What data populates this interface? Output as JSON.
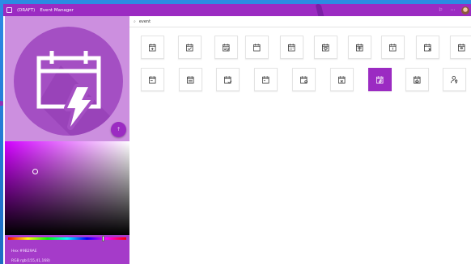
{
  "window": {
    "status": "(DRAFT)",
    "title": "Event Manager"
  },
  "search": {
    "value": "event"
  },
  "preview": {
    "icon": "calendar-lightning-icon",
    "fab_label": "⇡"
  },
  "color": {
    "hex_label": "Hex #9B29AE",
    "rgb_label": "RGB rgb(155,41,168)",
    "accent": "#9b2bc2"
  },
  "icon_results": [
    {
      "name": "calendar-add-icon"
    },
    {
      "name": "calendar-check-icon"
    },
    {
      "name": "calendar-edit-icon"
    },
    {
      "name": "calendar-icon"
    },
    {
      "name": "calendar-month-icon"
    },
    {
      "name": "calendar-heart-icon"
    },
    {
      "name": "calendar-week-icon"
    },
    {
      "name": "calendar-day-icon"
    },
    {
      "name": "calendar-remove-icon"
    },
    {
      "name": "calendar-today-icon"
    },
    {
      "name": "calendar-schedule-icon"
    },
    {
      "name": "calendar-agenda-icon"
    },
    {
      "name": "calendar-approved-icon"
    },
    {
      "name": "calendar-date-icon"
    },
    {
      "name": "calendar-settings-icon"
    },
    {
      "name": "calendar-close-icon"
    },
    {
      "name": "calendar-lightning-icon",
      "selected": true
    },
    {
      "name": "calendar-star-icon"
    },
    {
      "name": "person-key-icon"
    }
  ]
}
